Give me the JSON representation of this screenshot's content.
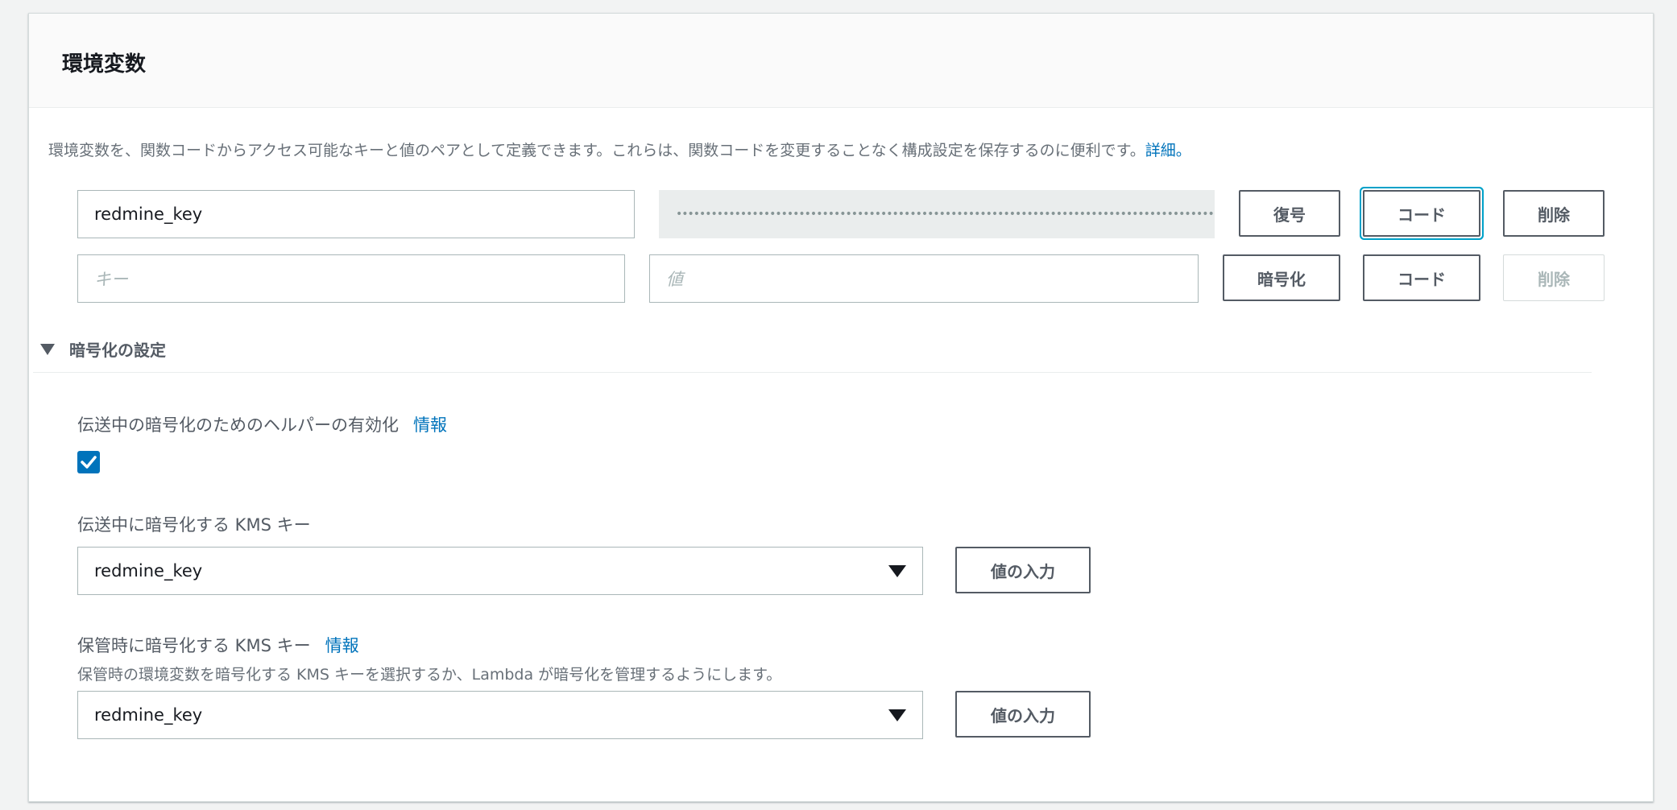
{
  "panel": {
    "title": "環境変数",
    "description": "環境変数を、関数コードからアクセス可能なキーと値のペアとして定義できます。これらは、関数コードを変更することなく構成設定を保存するのに便利です。",
    "description_link": "詳細。"
  },
  "env_rows": [
    {
      "key": "redmine_key",
      "value_masked": "••••••••••••••••••••••••••••••••••••••••••••••••••••••••••••••••••••••••••••••••••••••••••••••••",
      "action_label": "復号",
      "code_label": "コード",
      "delete_label": "削除"
    },
    {
      "key_placeholder": "キー",
      "value_placeholder": "値",
      "action_label": "暗号化",
      "code_label": "コード",
      "delete_label": "削除"
    }
  ],
  "encryption": {
    "section_label": "暗号化の設定",
    "helper_label": "伝送中の暗号化のためのヘルパーの有効化",
    "helper_info": "情報",
    "helper_checked": true,
    "transit_label": "伝送中に暗号化する KMS キー",
    "transit_value": "redmine_key",
    "transit_button": "値の入力",
    "rest_label": "保管時に暗号化する KMS キー",
    "rest_info": "情報",
    "rest_description": "保管時の環境変数を暗号化する KMS キーを選択するか、Lambda が暗号化を管理するようにします。",
    "rest_value": "redmine_key",
    "rest_button": "値の入力"
  },
  "colors": {
    "accent": "#0073bb",
    "focus_ring": "#00a1c9",
    "button_border": "#545b64"
  }
}
